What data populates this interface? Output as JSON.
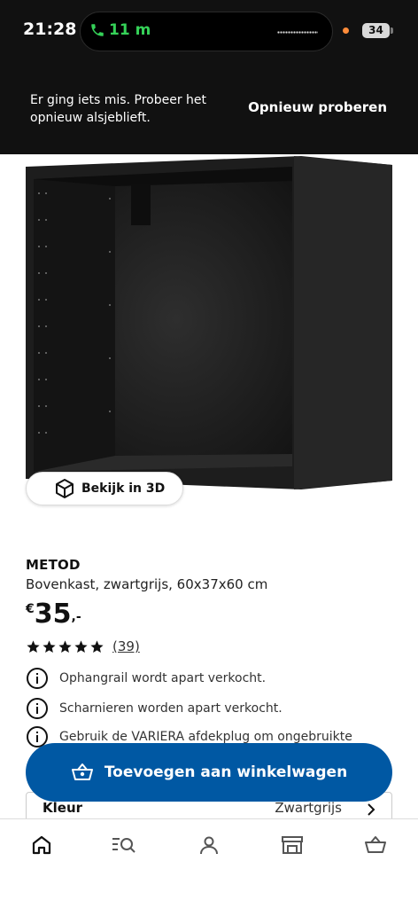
{
  "status_bar": {
    "time": "21:28",
    "call_duration": "11 m",
    "battery": "34"
  },
  "error_banner": {
    "message": "Er ging iets mis. Probeer het opnieuw alsjeblieft.",
    "retry_label": "Opnieuw proberen"
  },
  "product": {
    "view3d_label": "Bekijk in 3D",
    "brand": "METOD",
    "description": "Bovenkast, zwartgrijs, 60x37x60 cm",
    "price_currency": "€",
    "price_amount": "35",
    "price_suffix": ",-",
    "rating": 5,
    "review_count": "(39)",
    "info_lines": [
      "Ophangrail wordt apart verkocht.",
      "Scharnieren worden apart verkocht.",
      "Gebruik de VARIERA afdekplug om ongebruikte"
    ],
    "color_label": "Kleur",
    "color_value": "Zwartgrijs"
  },
  "cart_button": {
    "label": "Toevoegen aan winkelwagen"
  },
  "tabbar": {
    "items": [
      "home-icon",
      "search-list-icon",
      "profile-icon",
      "store-icon",
      "basket-icon"
    ]
  },
  "colors": {
    "accent": "#0058a3",
    "call_green": "#35d158",
    "dark": "#111111"
  }
}
